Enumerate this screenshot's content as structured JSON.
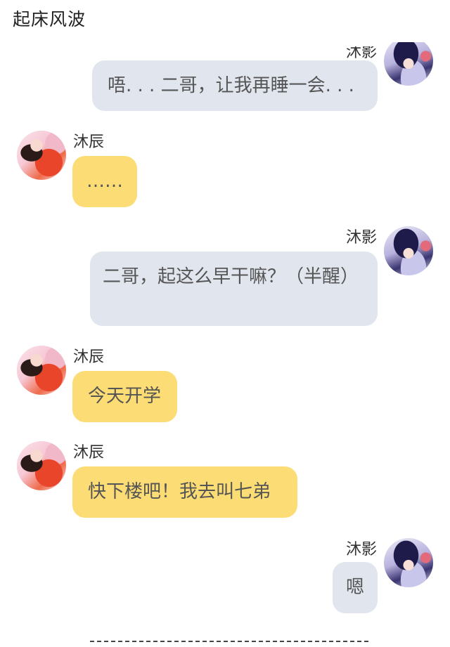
{
  "title": "起床风波",
  "messages": [
    {
      "sender": "沐影",
      "side": "right",
      "color": "#e1e6ee",
      "text": "唔. . . 二哥，让我再睡一会. . ."
    },
    {
      "sender": "沐辰",
      "side": "left",
      "color": "#fcdc74",
      "text": "……"
    },
    {
      "sender": "沐影",
      "side": "right",
      "color": "#e1e6ee",
      "text": "二哥，起这么早干嘛？（半醒）"
    },
    {
      "sender": "沐辰",
      "side": "left",
      "color": "#fcdc74",
      "text": "今天开学"
    },
    {
      "sender": "沐辰",
      "side": "left",
      "color": "#fcdc74",
      "text": "快下楼吧！我去叫七弟"
    },
    {
      "sender": "沐影",
      "side": "right",
      "color": "#e1e6ee",
      "text": "嗯"
    }
  ],
  "avatars": {
    "沐辰": "avatar-chen-icon",
    "沐影": "avatar-ying-icon"
  }
}
